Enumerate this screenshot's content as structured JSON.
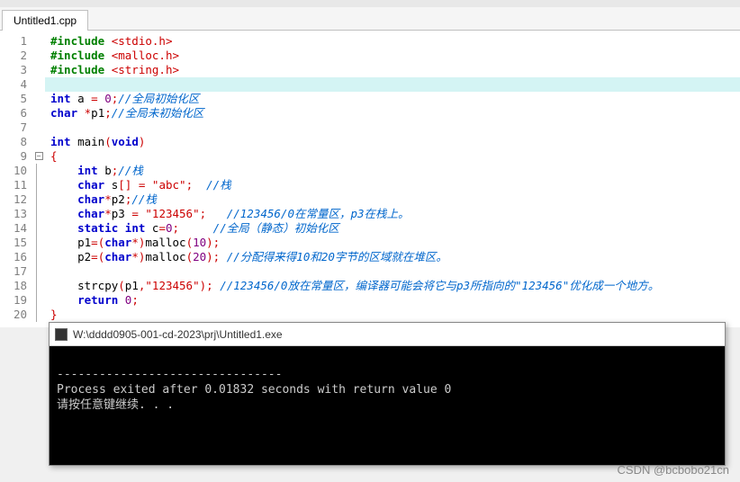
{
  "tab": {
    "label": "Untitled1.cpp"
  },
  "gutter": [
    "1",
    "2",
    "3",
    "4",
    "5",
    "6",
    "7",
    "8",
    "9",
    "10",
    "11",
    "12",
    "13",
    "14",
    "15",
    "16",
    "17",
    "18",
    "19",
    "20"
  ],
  "fold": {
    "minus": "−"
  },
  "code": {
    "l1": {
      "pp": "#include ",
      "inc": "<stdio.h>"
    },
    "l2": {
      "pp": "#include ",
      "inc": "<malloc.h>"
    },
    "l3": {
      "pp": "#include ",
      "inc": "<string.h>"
    },
    "l5": {
      "kw1": "int",
      "id": " a ",
      "op": "=",
      "sp": " ",
      "num": "0",
      "op2": ";",
      "cmt": "//全局初始化区"
    },
    "l6": {
      "kw1": "char",
      "sp": " ",
      "op": "*",
      "id": "p1",
      "op2": ";",
      "cmt": "//全局未初始化区"
    },
    "l8": {
      "kw1": "int",
      "sp": " ",
      "fn": "main",
      "op": "(",
      "kw2": "void",
      "op2": ")"
    },
    "l9": {
      "brace": "{"
    },
    "l10": {
      "kw": "int",
      "sp": " ",
      "id": "b",
      "op": ";",
      "cmt": "//栈"
    },
    "l11": {
      "kw": "char",
      "sp": " ",
      "id": "s",
      "op1": "[] = ",
      "str": "\"abc\"",
      "op2": ";",
      "sp2": "  ",
      "cmt": "//栈"
    },
    "l12": {
      "kw": "char",
      "op": "*",
      "id": "p2",
      "op2": ";",
      "cmt": "//栈"
    },
    "l13": {
      "kw": "char",
      "op": "*",
      "id": "p3 ",
      "op2": "= ",
      "str": "\"123456\"",
      "op3": ";",
      "sp": "   ",
      "cmt": "//123456/0在常量区，p3在栈上。"
    },
    "l14": {
      "kw": "static int",
      "sp": " ",
      "id": "c",
      "op": "=",
      "num": "0",
      "op2": ";",
      "sp2": "     ",
      "cmt": "//全局（静态）初始化区"
    },
    "l15": {
      "id": "p1",
      "op": "=(",
      "kw": "char",
      "op2": "*)",
      "fn": "malloc",
      "op3": "(",
      "num": "10",
      "op4": ");"
    },
    "l16": {
      "id": "p2",
      "op": "=(",
      "kw": "char",
      "op2": "*)",
      "fn": "malloc",
      "op3": "(",
      "num": "20",
      "op4": ");",
      "sp": " ",
      "cmt": "//分配得来得10和20字节的区域就在堆区。"
    },
    "l18": {
      "fn": "strcpy",
      "op": "(",
      "id": "p1",
      "op2": ",",
      "str": "\"123456\"",
      "op3": ");",
      "sp": " ",
      "cmt": "//123456/0放在常量区，编译器可能会将它与p3所指向的\"123456\"优化成一个地方。"
    },
    "l19": {
      "kw": "return",
      "sp": " ",
      "num": "0",
      "op": ";"
    },
    "l20": {
      "brace": "}"
    }
  },
  "console": {
    "title": "W:\\dddd0905-001-cd-2023\\prj\\Untitled1.exe",
    "sep": "--------------------------------",
    "exit": "Process exited after 0.01832 seconds with return value 0",
    "prompt": "请按任意键继续. . ."
  },
  "watermark": "CSDN @bcbobo21cn"
}
